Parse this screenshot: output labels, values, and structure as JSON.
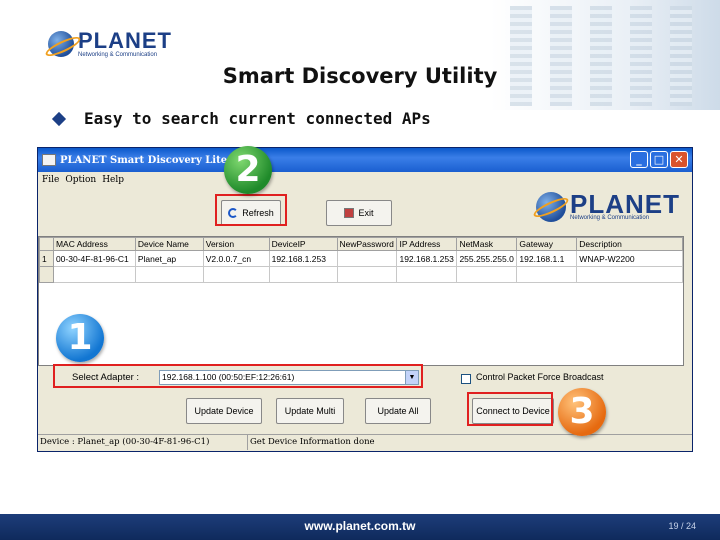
{
  "slide": {
    "logo_text": "PLANET",
    "logo_subtitle": "Networking & Communication",
    "title": "Smart Discovery Utility",
    "bullet": "Easy to search current connected APs",
    "footer_url": "www.planet.com.tw",
    "page_number": "19 / 24"
  },
  "window": {
    "title": "PLANET Smart Discovery Lite",
    "controls": {
      "minimize": "_",
      "maximize": "□",
      "close": "✕"
    },
    "menu": [
      "File",
      "Option",
      "Help"
    ],
    "toolbar": {
      "refresh_label": "Refresh",
      "exit_label": "Exit"
    },
    "logo_text": "PLANET",
    "logo_subtitle": "Networking & Communication"
  },
  "table": {
    "headers": [
      "MAC Address",
      "Device Name",
      "Version",
      "DeviceIP",
      "NewPassword",
      "IP Address",
      "NetMask",
      "Gateway",
      "Description"
    ],
    "rows": [
      {
        "index": "1",
        "cells": [
          "00-30-4F-81-96-C1",
          "Planet_ap",
          "V2.0.0.7_cn",
          "192.168.1.253",
          "",
          "192.168.1.253",
          "255.255.255.0",
          "192.168.1.1",
          "WNAP-W2200"
        ]
      }
    ]
  },
  "adapter": {
    "label": "Select Adapter :",
    "value": "192.168.1.100 (00:50:EF:12:26:61)",
    "checkbox_label": "Control Packet Force Broadcast"
  },
  "buttons": {
    "update_device": "Update Device",
    "update_multi": "Update Multi",
    "update_all": "Update All",
    "connect": "Connect to Device"
  },
  "status": {
    "device": "Device : Planet_ap (00-30-4F-81-96-C1)",
    "message": "Get Device Information done"
  },
  "callouts": {
    "one": "1",
    "two": "2",
    "three": "3"
  }
}
